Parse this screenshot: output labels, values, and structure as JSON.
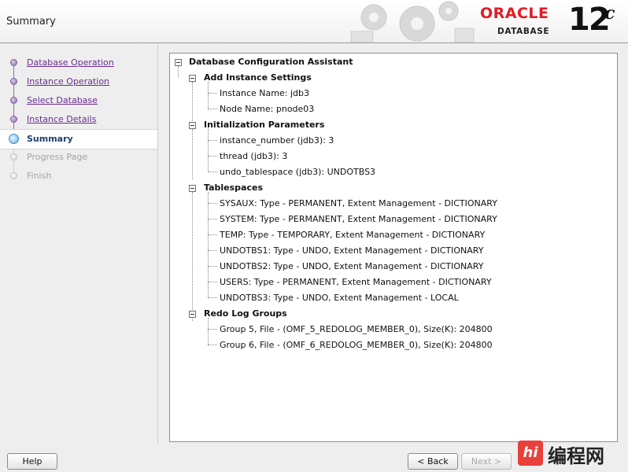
{
  "header": {
    "title": "Summary",
    "logo_text": "ORACLE",
    "logo_subtext": "DATABASE",
    "version": "12",
    "version_suffix": "c"
  },
  "steps": [
    {
      "label": "Database Operation",
      "state": "done"
    },
    {
      "label": "Instance Operation",
      "state": "done"
    },
    {
      "label": "Select Database",
      "state": "done"
    },
    {
      "label": "Instance Details",
      "state": "done"
    },
    {
      "label": "Summary",
      "state": "current"
    },
    {
      "label": "Progress Page",
      "state": "future"
    },
    {
      "label": "Finish",
      "state": "future"
    }
  ],
  "tree": {
    "root": "Database Configuration Assistant",
    "sections": [
      {
        "label": "Add Instance Settings",
        "items": [
          "Instance Name: jdb3",
          "Node Name: pnode03"
        ]
      },
      {
        "label": "Initialization Parameters",
        "items": [
          "instance_number (jdb3): 3",
          "thread (jdb3): 3",
          "undo_tablespace (jdb3): UNDOTBS3"
        ]
      },
      {
        "label": "Tablespaces",
        "items": [
          "SYSAUX: Type - PERMANENT, Extent Management - DICTIONARY",
          "SYSTEM: Type - PERMANENT, Extent Management - DICTIONARY",
          "TEMP: Type - TEMPORARY, Extent Management - DICTIONARY",
          "UNDOTBS1: Type - UNDO, Extent Management - DICTIONARY",
          "UNDOTBS2: Type - UNDO, Extent Management - DICTIONARY",
          "USERS: Type - PERMANENT, Extent Management - DICTIONARY",
          "UNDOTBS3: Type - UNDO, Extent Management - LOCAL"
        ]
      },
      {
        "label": "Redo Log Groups",
        "items": [
          "Group 5, File - (OMF_5_REDOLOG_MEMBER_0), Size(K): 204800",
          "Group 6, File - (OMF_6_REDOLOG_MEMBER_0), Size(K): 204800"
        ]
      }
    ]
  },
  "buttons": {
    "help": "Help",
    "back": "< Back",
    "next": "Next >"
  },
  "watermark": {
    "logo": "hi",
    "text": "编程网"
  },
  "colors": {
    "oracle_red": "#e31b23",
    "step_link": "#6a2c8e",
    "step_current": "#1f3d6b"
  }
}
